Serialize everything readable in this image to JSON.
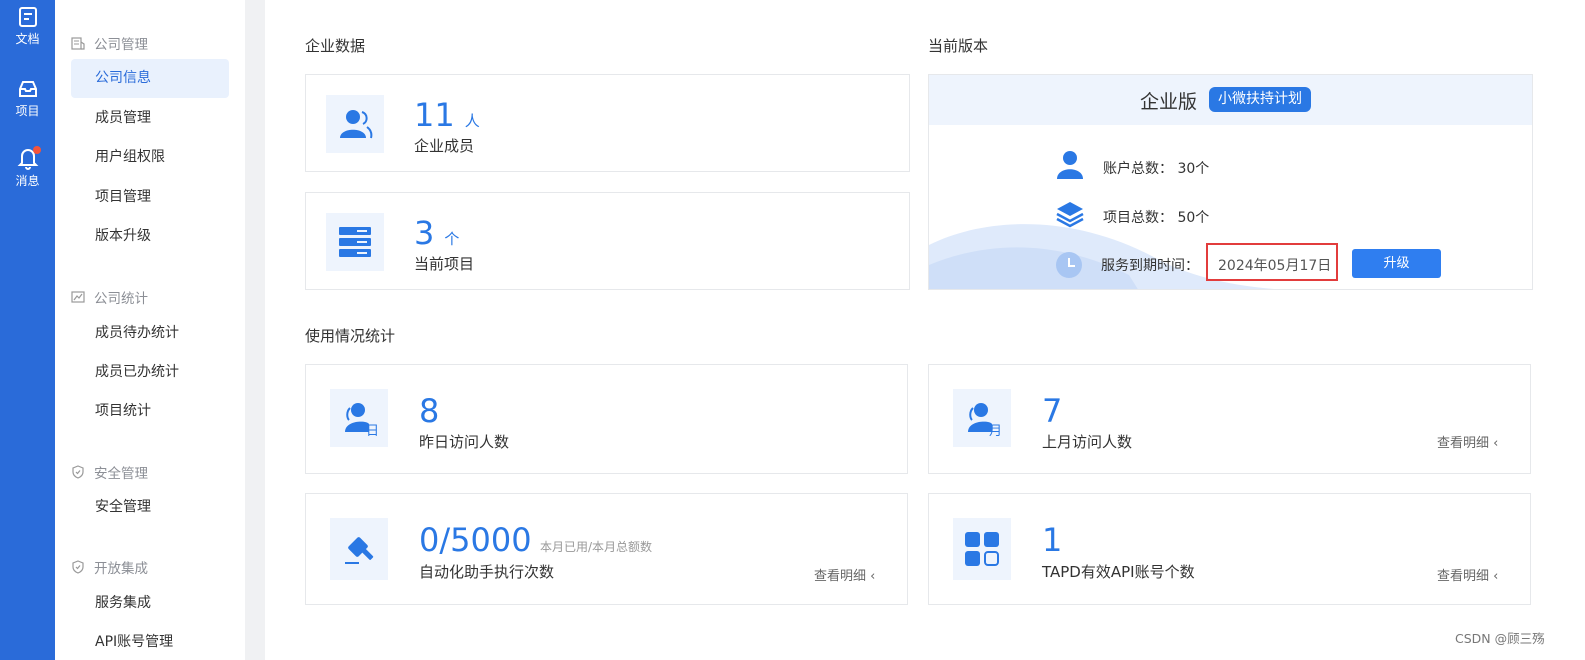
{
  "rail": {
    "items": [
      {
        "label": "文档",
        "icon": "document-icon"
      },
      {
        "label": "项目",
        "icon": "inbox-icon"
      },
      {
        "label": "消息",
        "icon": "bell-icon"
      }
    ]
  },
  "sidebar": {
    "groups": [
      {
        "label": "公司管理",
        "icon": "company-icon",
        "items": [
          "公司信息",
          "成员管理",
          "用户组权限",
          "项目管理",
          "版本升级"
        ]
      },
      {
        "label": "公司统计",
        "icon": "chart-icon",
        "items": [
          "成员待办统计",
          "成员已办统计",
          "项目统计"
        ]
      },
      {
        "label": "安全管理",
        "icon": "shield-icon",
        "items": [
          "安全管理"
        ]
      },
      {
        "label": "开放集成",
        "icon": "shield-icon",
        "items": [
          "服务集成",
          "API账号管理"
        ]
      }
    ],
    "active_item": "公司信息"
  },
  "enterprise_data": {
    "title": "企业数据",
    "members": {
      "value": "11",
      "unit": "人",
      "label": "企业成员"
    },
    "projects": {
      "value": "3",
      "unit": "个",
      "label": "当前项目"
    }
  },
  "version": {
    "title": "当前版本",
    "edition": "企业版",
    "badge": "小微扶持计划",
    "accounts": "账户总数： 30个",
    "project_total": "项目总数： 50个",
    "expire_label": "服务到期时间：",
    "expire_date": "2024年05月17日",
    "upgrade_label": "升级"
  },
  "usage": {
    "title": "使用情况统计",
    "yesterday": {
      "value": "8",
      "label": "昨日访问人数",
      "icon_char": "日"
    },
    "last_month": {
      "value": "7",
      "label": "上月访问人数",
      "icon_char": "月",
      "link": "查看明细"
    },
    "automation": {
      "value": "0/5000",
      "note": "本月已用/本月总额数",
      "label": "自动化助手执行次数",
      "link": "查看明细"
    },
    "api": {
      "value": "1",
      "label": "TAPD有效API账号个数",
      "link": "查看明细"
    }
  },
  "colors": {
    "rail": "#2a6bd9",
    "accent": "#2a78e4",
    "highlight": "#e23c3c"
  },
  "watermark": "CSDN @顾三殇"
}
